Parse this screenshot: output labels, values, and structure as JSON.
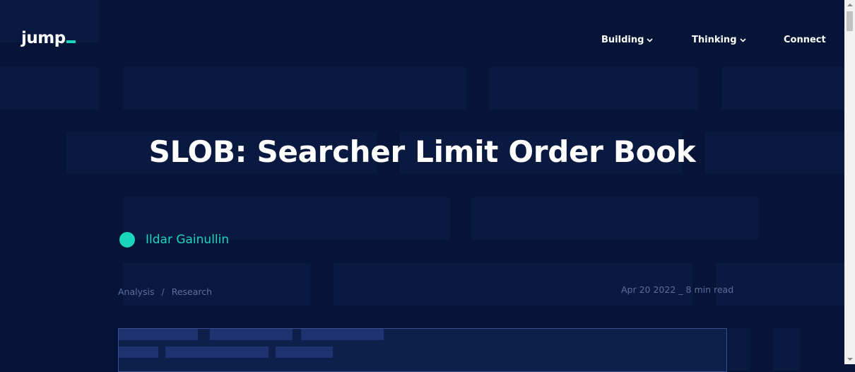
{
  "header": {
    "logo_text": "jump",
    "nav": [
      {
        "label": "Building",
        "icon": "chevron-down-icon"
      },
      {
        "label": "Thinking",
        "icon": "chevron-down-icon"
      },
      {
        "label": "Connect"
      }
    ]
  },
  "article": {
    "title": "SLOB: Searcher Limit Order Book",
    "author": "Ildar Gainullin",
    "categories": [
      "Analysis",
      "Research"
    ],
    "separator": "/",
    "date": "Apr 20 2022",
    "read_time": "8 min read",
    "meta_separator": "_"
  },
  "colors": {
    "background": "#061537",
    "accent": "#19d6bb",
    "muted_text": "#5a6f9e"
  }
}
